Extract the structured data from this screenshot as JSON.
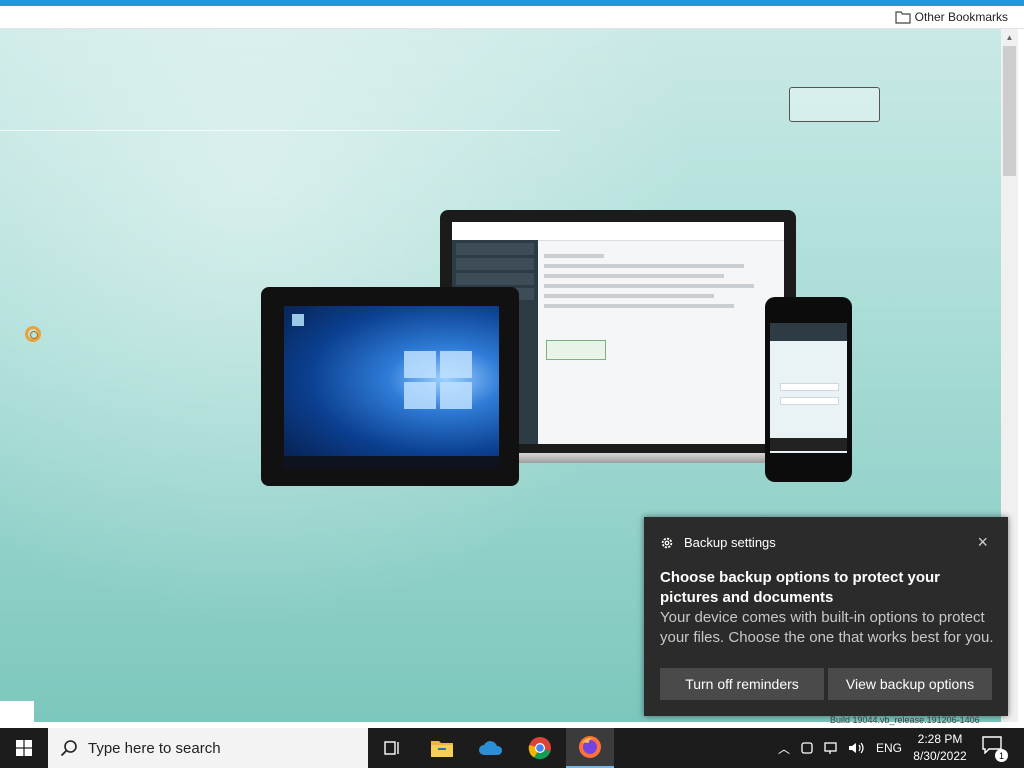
{
  "browser": {
    "bookmarks_bar": {
      "other_bookmarks": "Other Bookmarks"
    },
    "status_text": "Build 19044.vb_release.191206-1406"
  },
  "toast": {
    "header": "Backup settings",
    "close_symbol": "×",
    "title": "Choose backup options to protect your pictures and documents",
    "body": "Your device comes with built-in options to protect your files. Choose the one that works best for you.",
    "buttons": {
      "turn_off": "Turn off reminders",
      "view": "View backup options"
    }
  },
  "taskbar": {
    "search_placeholder": "Type here to search",
    "pinned": [
      "task-view-icon",
      "file-explorer-icon",
      "onedrive-icon",
      "chrome-icon",
      "firefox-icon"
    ],
    "tray": {
      "language": "ENG",
      "time": "2:28 PM",
      "date": "8/30/2022",
      "notification_count": "1"
    }
  },
  "colors": {
    "accent": "#1f9bd3",
    "toast_bg": "#2b2b2b",
    "toast_button": "#4a4a4a",
    "taskbar": "#1c1c1c"
  }
}
